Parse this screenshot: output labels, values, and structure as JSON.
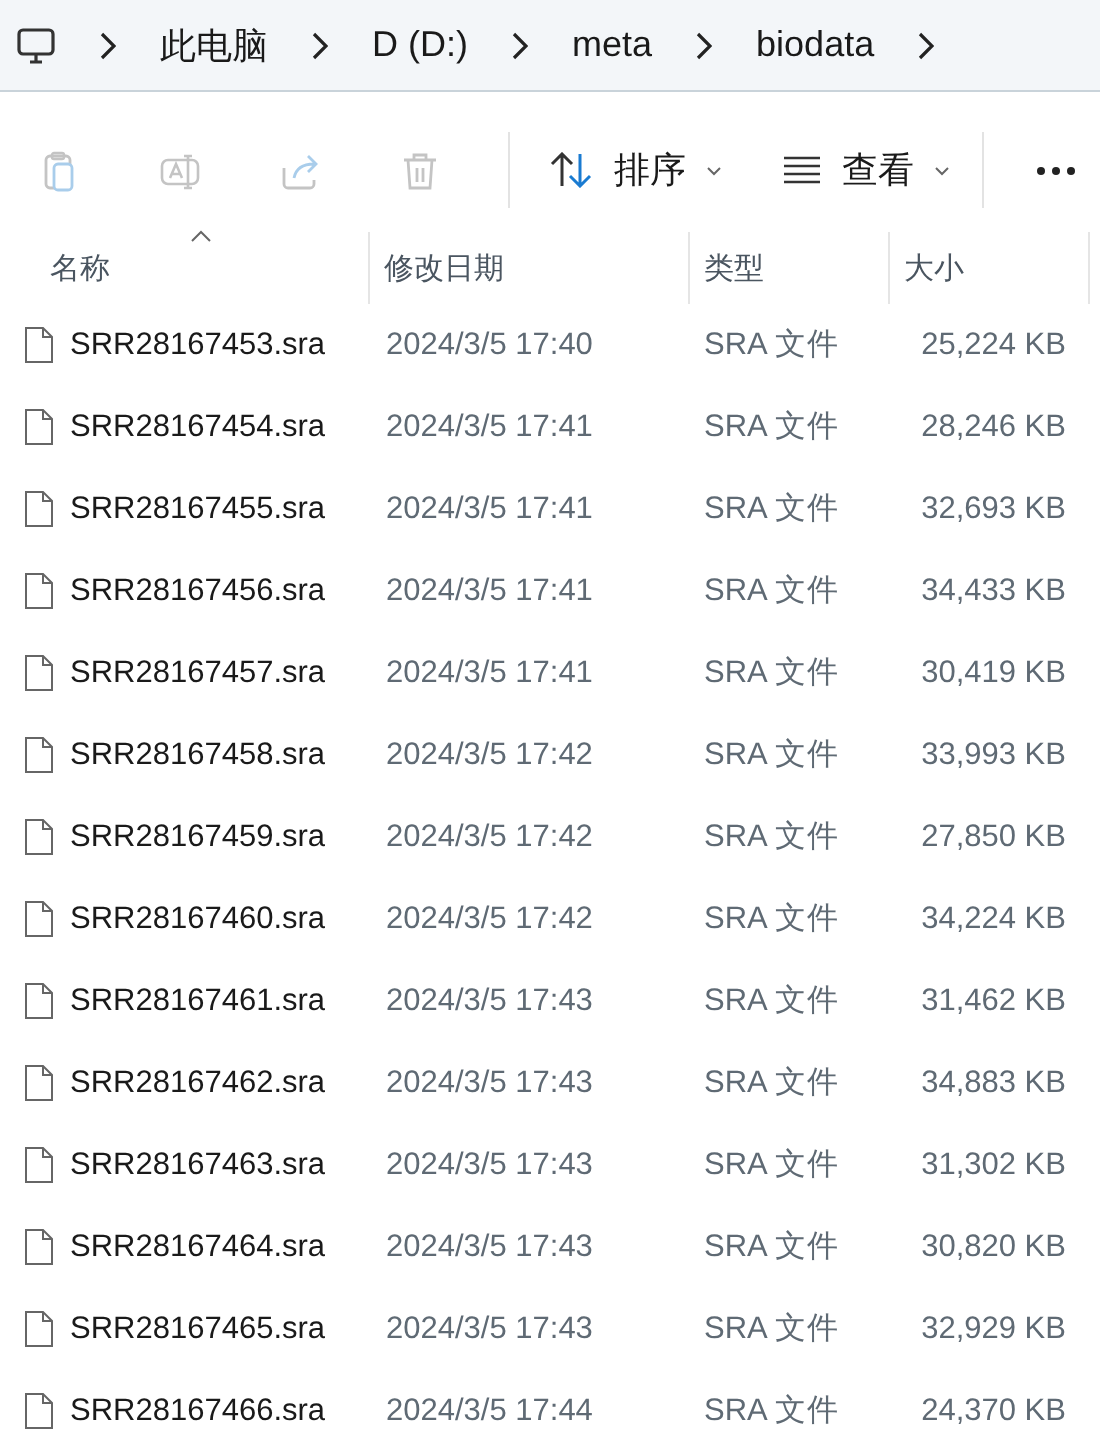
{
  "breadcrumb": {
    "items": [
      "此电脑",
      "D (D:)",
      "meta",
      "biodata"
    ]
  },
  "toolbar": {
    "actions": [
      {
        "kind": "paste",
        "disabled": true
      },
      {
        "kind": "rename",
        "disabled": true
      },
      {
        "kind": "share",
        "disabled": true
      },
      {
        "kind": "delete",
        "disabled": true
      }
    ],
    "sort_label": "排序",
    "view_label": "查看"
  },
  "table": {
    "columns": [
      {
        "label": "名称",
        "sorted": true
      },
      {
        "label": "修改日期",
        "sorted": false
      },
      {
        "label": "类型",
        "sorted": false
      },
      {
        "label": "大小",
        "sorted": false
      }
    ],
    "rows": [
      {
        "name": "SRR28167453.sra",
        "date": "2024/3/5 17:40",
        "type": "SRA 文件",
        "size": "25,224 KB"
      },
      {
        "name": "SRR28167454.sra",
        "date": "2024/3/5 17:41",
        "type": "SRA 文件",
        "size": "28,246 KB"
      },
      {
        "name": "SRR28167455.sra",
        "date": "2024/3/5 17:41",
        "type": "SRA 文件",
        "size": "32,693 KB"
      },
      {
        "name": "SRR28167456.sra",
        "date": "2024/3/5 17:41",
        "type": "SRA 文件",
        "size": "34,433 KB"
      },
      {
        "name": "SRR28167457.sra",
        "date": "2024/3/5 17:41",
        "type": "SRA 文件",
        "size": "30,419 KB"
      },
      {
        "name": "SRR28167458.sra",
        "date": "2024/3/5 17:42",
        "type": "SRA 文件",
        "size": "33,993 KB"
      },
      {
        "name": "SRR28167459.sra",
        "date": "2024/3/5 17:42",
        "type": "SRA 文件",
        "size": "27,850 KB"
      },
      {
        "name": "SRR28167460.sra",
        "date": "2024/3/5 17:42",
        "type": "SRA 文件",
        "size": "34,224 KB"
      },
      {
        "name": "SRR28167461.sra",
        "date": "2024/3/5 17:43",
        "type": "SRA 文件",
        "size": "31,462 KB"
      },
      {
        "name": "SRR28167462.sra",
        "date": "2024/3/5 17:43",
        "type": "SRA 文件",
        "size": "34,883 KB"
      },
      {
        "name": "SRR28167463.sra",
        "date": "2024/3/5 17:43",
        "type": "SRA 文件",
        "size": "31,302 KB"
      },
      {
        "name": "SRR28167464.sra",
        "date": "2024/3/5 17:43",
        "type": "SRA 文件",
        "size": "30,820 KB"
      },
      {
        "name": "SRR28167465.sra",
        "date": "2024/3/5 17:43",
        "type": "SRA 文件",
        "size": "32,929 KB"
      },
      {
        "name": "SRR28167466.sra",
        "date": "2024/3/5 17:44",
        "type": "SRA 文件",
        "size": "24,370 KB"
      }
    ]
  }
}
